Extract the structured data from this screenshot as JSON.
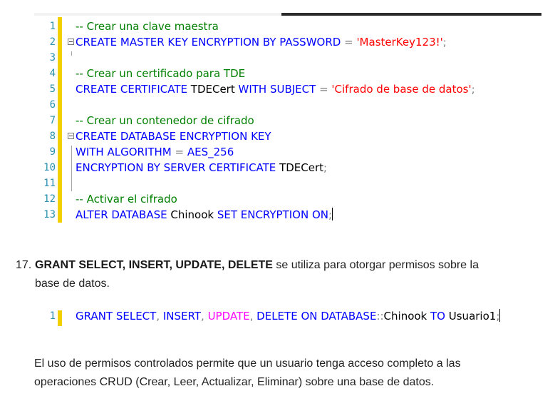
{
  "editor1": {
    "lines": [
      {
        "n": "1",
        "tokens": [
          {
            "t": "-- Crear una clave maestra",
            "c": "cm"
          }
        ]
      },
      {
        "n": "2",
        "fold": true,
        "tokens": [
          {
            "t": "CREATE MASTER KEY ENCRYPTION BY PASSWORD ",
            "c": "kw"
          },
          {
            "t": "=",
            "c": "gr"
          },
          {
            "t": " ",
            "c": "pl"
          },
          {
            "t": "'MasterKey123!'",
            "c": "str"
          },
          {
            "t": ";",
            "c": "gr"
          }
        ]
      },
      {
        "n": "3",
        "tokens": []
      },
      {
        "n": "4",
        "tokens": [
          {
            "t": "-- Crear un certificado para TDE",
            "c": "cm"
          }
        ]
      },
      {
        "n": "5",
        "tokens": [
          {
            "t": "CREATE CERTIFICATE ",
            "c": "kw"
          },
          {
            "t": "TDECert ",
            "c": "pl"
          },
          {
            "t": "WITH SUBJECT ",
            "c": "kw"
          },
          {
            "t": "=",
            "c": "gr"
          },
          {
            "t": " ",
            "c": "pl"
          },
          {
            "t": "'Cifrado de base de datos'",
            "c": "str"
          },
          {
            "t": ";",
            "c": "gr"
          }
        ]
      },
      {
        "n": "6",
        "tokens": []
      },
      {
        "n": "7",
        "tokens": [
          {
            "t": "-- Crear un contenedor de cifrado",
            "c": "cm"
          }
        ]
      },
      {
        "n": "8",
        "fold": true,
        "tokens": [
          {
            "t": "CREATE DATABASE ENCRYPTION KEY",
            "c": "kw"
          }
        ]
      },
      {
        "n": "9",
        "tokens": [
          {
            "t": "WITH ALGORITHM ",
            "c": "kw"
          },
          {
            "t": "=",
            "c": "gr"
          },
          {
            "t": " ",
            "c": "pl"
          },
          {
            "t": "AES_256",
            "c": "kw"
          }
        ]
      },
      {
        "n": "10",
        "tokens": [
          {
            "t": "ENCRYPTION BY SERVER CERTIFICATE ",
            "c": "kw"
          },
          {
            "t": "TDECert",
            "c": "pl"
          },
          {
            "t": ";",
            "c": "gr"
          }
        ]
      },
      {
        "n": "11",
        "tokens": []
      },
      {
        "n": "12",
        "tokens": [
          {
            "t": "-- Activar el cifrado",
            "c": "cm"
          }
        ]
      },
      {
        "n": "13",
        "caret": true,
        "tokens": [
          {
            "t": "ALTER DATABASE ",
            "c": "kw"
          },
          {
            "t": "Chinook ",
            "c": "pl"
          },
          {
            "t": "SET ENCRYPTION ON",
            "c": "kw"
          },
          {
            "t": ";",
            "c": "gr"
          }
        ]
      }
    ]
  },
  "item17": {
    "number": "17.",
    "bold": "GRANT SELECT, INSERT, UPDATE, DELETE",
    "text": " se utiliza para otorgar permisos sobre la base de datos."
  },
  "editor2": {
    "lines": [
      {
        "n": "1",
        "caret": true,
        "tokens": [
          {
            "t": "GRANT SELECT",
            "c": "kw"
          },
          {
            "t": ", ",
            "c": "gr"
          },
          {
            "t": "INSERT",
            "c": "kw"
          },
          {
            "t": ", ",
            "c": "gr"
          },
          {
            "t": "UPDATE",
            "c": "fn"
          },
          {
            "t": ", ",
            "c": "gr"
          },
          {
            "t": "DELETE ON DATABASE",
            "c": "kw"
          },
          {
            "t": "::",
            "c": "gr"
          },
          {
            "t": "Chinook ",
            "c": "pl"
          },
          {
            "t": "TO ",
            "c": "kw"
          },
          {
            "t": "Usuario1",
            "c": "pl"
          },
          {
            "t": ";",
            "c": "gr"
          }
        ]
      }
    ]
  },
  "paragraph": "El uso de permisos controlados permite que un usuario tenga acceso completo a las operaciones CRUD (Crear, Leer, Actualizar, Eliminar) sobre una base de datos."
}
